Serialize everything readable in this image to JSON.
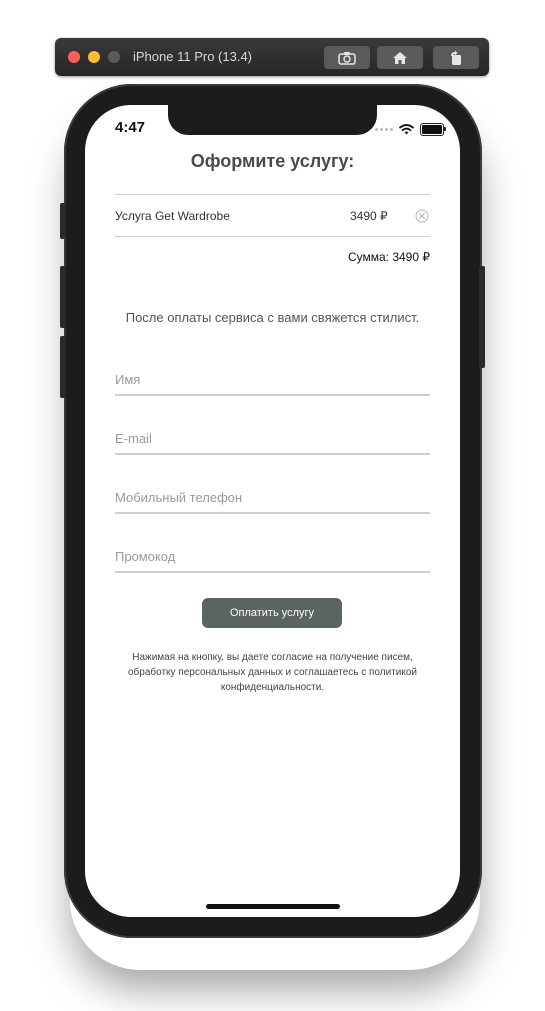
{
  "simulator": {
    "title": "iPhone 11 Pro (13.4)",
    "buttons": [
      "screenshot-icon",
      "home-icon",
      "rotate-icon"
    ]
  },
  "status_bar": {
    "time": "4:47"
  },
  "checkout": {
    "title": "Оформите услугу:",
    "service_name": "Услуга Get Wardrobe",
    "service_price": "3490 ₽",
    "sum": "Сумма: 3490 ₽",
    "info": "После оплаты сервиса с вами свяжется стилист.",
    "fields": {
      "name_placeholder": "Имя",
      "email_placeholder": "E-mail",
      "phone_placeholder": "Мобильный телефон",
      "promo_placeholder": "Промокод"
    },
    "pay_button": "Оплатить услугу",
    "consent": "Нажимая на кнопку, вы даете согласие на получение писем, обработку персональных данных и соглашаетесь с политикой конфиденциальности."
  },
  "colors": {
    "button_bg": "#5b6462",
    "divider": "#cfcfcf",
    "title_text": "#4a4a4a"
  }
}
